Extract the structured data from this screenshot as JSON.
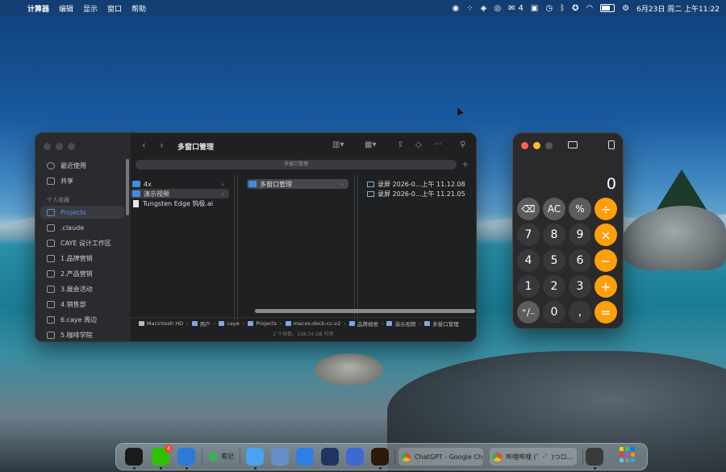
{
  "menubar": {
    "app_name": "计算器",
    "menus": [
      "编辑",
      "显示",
      "窗口",
      "帮助"
    ],
    "wechat_count": "4",
    "datetime": "6月23日 周二 上午11:22",
    "battery_level": 0.8
  },
  "finder": {
    "title": "多窗口管理",
    "tab_label": "多窗口管理",
    "sidebar": {
      "recent": "最近使用",
      "shared": "共享",
      "section_header": "个人收藏",
      "items": [
        "Projects",
        ".claude",
        "CAYE 设计工作区",
        "1.品牌营销",
        "2.产品营销",
        "3.展会活动",
        "4.销售部",
        "6.caye 周边",
        "5.咖啡学院"
      ]
    },
    "col1": [
      {
        "name": "4x",
        "type": "folder",
        "state": "none"
      },
      {
        "name": "演示视频",
        "type": "folder",
        "state": "selected"
      },
      {
        "name": "Tungsten Edge 钨极.ai",
        "type": "doc",
        "state": "none"
      }
    ],
    "col2": [
      {
        "name": "多窗口管理",
        "type": "folder",
        "state": "selected"
      }
    ],
    "col3": [
      {
        "name": "录屏 2026-0...上午 11.12.08"
      },
      {
        "name": "录屏 2026-0...上午 11.21.05"
      }
    ],
    "path": [
      "Macintosh HD",
      "用户",
      "caye",
      "Projects",
      "macos-dock-cc-v2",
      "品牌视觉",
      "演示视频",
      "多窗口管理"
    ],
    "status": "2 个项目，138.34 GB 可用"
  },
  "calculator": {
    "display": "0",
    "rows": [
      [
        {
          "label": "⌫",
          "kind": "fn"
        },
        {
          "label": "AC",
          "kind": "fn"
        },
        {
          "label": "%",
          "kind": "fn"
        },
        {
          "label": "÷",
          "kind": "op"
        }
      ],
      [
        {
          "label": "7",
          "kind": "num"
        },
        {
          "label": "8",
          "kind": "num"
        },
        {
          "label": "9",
          "kind": "num"
        },
        {
          "label": "×",
          "kind": "op"
        }
      ],
      [
        {
          "label": "4",
          "kind": "num"
        },
        {
          "label": "5",
          "kind": "num"
        },
        {
          "label": "6",
          "kind": "num"
        },
        {
          "label": "−",
          "kind": "op"
        }
      ],
      [
        {
          "label": "1",
          "kind": "num"
        },
        {
          "label": "2",
          "kind": "num"
        },
        {
          "label": "3",
          "kind": "num"
        },
        {
          "label": "+",
          "kind": "op"
        }
      ],
      [
        {
          "label": "⁺∕₋",
          "kind": "fn"
        },
        {
          "label": "0",
          "kind": "num"
        },
        {
          "label": ",",
          "kind": "num"
        },
        {
          "label": "=",
          "kind": "op"
        }
      ]
    ]
  },
  "dock": {
    "wechat_badge": "4",
    "notes_label": "笔记",
    "window1": "ChatGPT - Google Chr...",
    "window2": "哔哩哔哩 (゜-゜)つロ...",
    "colors": {
      "qq": "#1a1a1a",
      "wechat": "#2dc100",
      "mail": "#2a7ad8",
      "notes": "#3bb34a",
      "finder": "#4aa3f0",
      "app6": "#6a8ec8",
      "safari": "#2f7ee8",
      "app8": "#1f3560",
      "app9": "#3d6ad0",
      "illustrator": "#2e1a08",
      "calculator": "#3a3a3c"
    }
  }
}
